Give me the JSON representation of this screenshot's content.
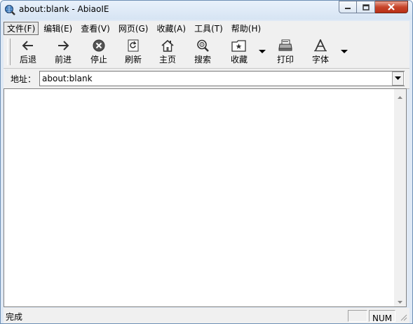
{
  "window": {
    "title": "about:blank - AbiaoIE",
    "app_icon": "ie-globe-magnifier-icon"
  },
  "menu": {
    "items": [
      {
        "label": "文件(F)",
        "active": true
      },
      {
        "label": "编辑(E)"
      },
      {
        "label": "查看(V)"
      },
      {
        "label": "网页(G)"
      },
      {
        "label": "收藏(A)"
      },
      {
        "label": "工具(T)"
      },
      {
        "label": "帮助(H)"
      }
    ]
  },
  "toolbar": {
    "back": {
      "label": "后退",
      "icon": "back-arrow-icon"
    },
    "forward": {
      "label": "前进",
      "icon": "forward-arrow-icon"
    },
    "stop": {
      "label": "停止",
      "icon": "stop-icon"
    },
    "refresh": {
      "label": "刷新",
      "icon": "refresh-icon"
    },
    "home": {
      "label": "主页",
      "icon": "home-icon"
    },
    "search": {
      "label": "搜索",
      "icon": "search-icon"
    },
    "favorites": {
      "label": "收藏",
      "icon": "favorites-icon"
    },
    "print": {
      "label": "打印",
      "icon": "print-icon"
    },
    "font": {
      "label": "字体",
      "icon": "font-icon"
    }
  },
  "address": {
    "label": "地址：",
    "value": "about:blank"
  },
  "status": {
    "text": "完成",
    "num": "NUM"
  },
  "colors": {
    "title_bg": "#dce8f5",
    "bar_bg": "#f0f0f0",
    "close_red": "#c7452b"
  }
}
